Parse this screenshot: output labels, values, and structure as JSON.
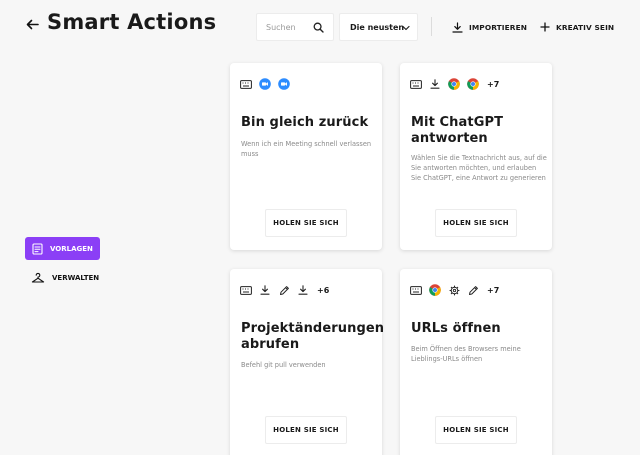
{
  "header": {
    "title": "Smart Actions",
    "search_placeholder": "Suchen",
    "sort_label": "Die neusten",
    "import_label": "IMPORTIEREN",
    "create_label": "KREATIV SEIN"
  },
  "sidebar": {
    "items": [
      {
        "label": "VORLAGEN",
        "icon": "template-icon",
        "active": true
      },
      {
        "label": "VERWALTEN",
        "icon": "hanger-icon",
        "active": false
      }
    ]
  },
  "colors": {
    "accent": "#8b3ff6",
    "zoom_blue": "#2d8cff"
  },
  "cards": [
    {
      "title": "Bin gleich zurück",
      "description": "Wenn ich ein Meeting schnell verlassen muss",
      "button": "HOLEN SIE SICH",
      "icons": [
        "keyboard-icon",
        "zoom-icon",
        "zoom-icon"
      ],
      "more": ""
    },
    {
      "title": "Mit ChatGPT antworten",
      "description": "Wählen Sie die Textnachricht aus, auf die Sie antworten möchten, und erlauben Sie ChatGPT, eine Antwort zu generieren",
      "button": "HOLEN SIE SICH",
      "icons": [
        "keyboard-icon",
        "download-icon",
        "chrome-icon",
        "chrome-icon"
      ],
      "more": "+7"
    },
    {
      "title": "Projektänderungen abrufen",
      "description": "Befehl git pull verwenden",
      "button": "HOLEN SIE SICH",
      "icons": [
        "keyboard-icon",
        "download-icon",
        "pencil-icon",
        "download-icon"
      ],
      "more": "+6"
    },
    {
      "title": "URLs öffnen",
      "description": "Beim Öffnen des Browsers meine Lieblings-URLs öffnen",
      "button": "HOLEN SIE SICH",
      "icons": [
        "keyboard-icon",
        "chrome-icon",
        "gear-icon",
        "pencil-icon"
      ],
      "more": "+7"
    }
  ]
}
